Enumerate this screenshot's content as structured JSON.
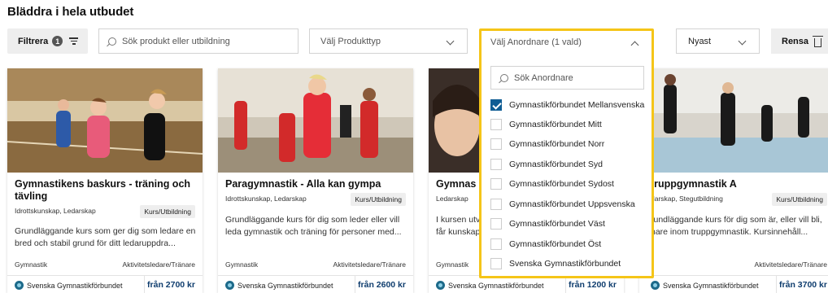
{
  "page": {
    "title": "Bläddra i hela utbudet"
  },
  "filters": {
    "filter_label": "Filtrera",
    "filter_count": "1",
    "search_placeholder": "Sök produkt eller utbildning",
    "product_type_label": "Välj Produkttyp",
    "organizer_label": "Välj Anordnare (1 vald)",
    "sort_label": "Nyast",
    "reset_label": "Rensa"
  },
  "organizer_dropdown": {
    "search_placeholder": "Sök Anordnare",
    "options": [
      {
        "label": "Gymnastikförbundet Mellansvenska",
        "checked": true
      },
      {
        "label": "Gymnastikförbundet Mitt",
        "checked": false
      },
      {
        "label": "Gymnastikförbundet Norr",
        "checked": false
      },
      {
        "label": "Gymnastikförbundet Syd",
        "checked": false
      },
      {
        "label": "Gymnastikförbundet Sydost",
        "checked": false
      },
      {
        "label": "Gymnastikförbundet Uppsvenska",
        "checked": false
      },
      {
        "label": "Gymnastikförbundet Väst",
        "checked": false
      },
      {
        "label": "Gymnastikförbundet Öst",
        "checked": false
      },
      {
        "label": "Svenska Gymnastikförbundet",
        "checked": false
      }
    ]
  },
  "cards": [
    {
      "title": "Gymnastikens baskurs - träning och tävling",
      "tags": "Idrottskunskap, Ledarskap",
      "badge": "Kurs/Utbildning",
      "description": "Grundläggande kurs som ger dig som ledare en bred och stabil grund för ditt ledaruppdra...",
      "subject": "Gymnastik",
      "role": "Aktivitetsledare/Tränare",
      "organizer": "Svenska Gymnastikförbundet",
      "price": "från 2700 kr"
    },
    {
      "title": "Paragymnastik - Alla kan gympa",
      "tags": "Idrottskunskap, Ledarskap",
      "badge": "Kurs/Utbildning",
      "description": "Grundläggande kurs för dig som leder eller vill leda gymnastik och träning för personer med...",
      "subject": "Gymnastik",
      "role": "Aktivitetsledare/Tränare",
      "organizer": "Svenska Gymnastikförbundet",
      "price": "från 2600 kr"
    },
    {
      "title": "Gymnas",
      "tags": "Ledarskap",
      "badge": "",
      "description": "I kursen utv får kunskap",
      "subject": "Gymnastik",
      "role": "",
      "organizer": "Svenska Gymnastikförbundet",
      "price": "från 1200 kr"
    },
    {
      "title": "truppgymnastik A",
      "tags": "darskap, Stegutbildning",
      "badge": "Kurs/Utbildning",
      "description": "rundläggande kurs för dig som är, eller vill bli, nare inom truppgymnastik. Kursinnehåll...",
      "subject": "",
      "role": "Aktivitetsledare/Tränare",
      "organizer": "Svenska Gymnastikförbundet",
      "price": "från 3700 kr"
    }
  ]
}
